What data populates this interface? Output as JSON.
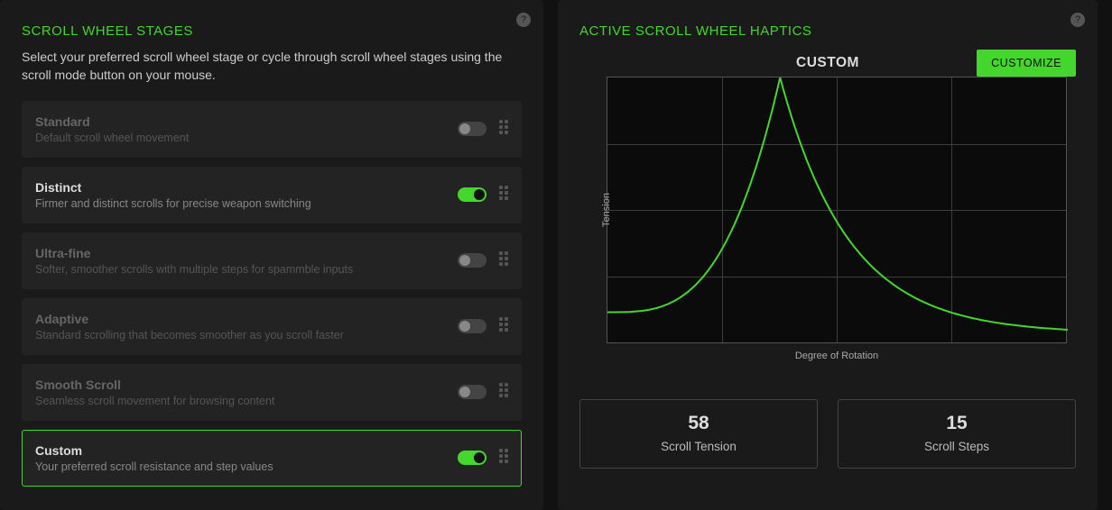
{
  "left": {
    "title": "SCROLL WHEEL STAGES",
    "description": "Select your preferred scroll wheel stage or cycle through scroll wheel stages using the scroll mode button on your mouse.",
    "stages": [
      {
        "title": "Standard",
        "sub": "Default scroll wheel movement",
        "on": false,
        "disabled": true,
        "selected": false
      },
      {
        "title": "Distinct",
        "sub": "Firmer and distinct scrolls for precise weapon switching",
        "on": true,
        "disabled": false,
        "selected": false
      },
      {
        "title": "Ultra-fine",
        "sub": "Softer, smoother scrolls with multiple steps for spammble inputs",
        "on": false,
        "disabled": true,
        "selected": false
      },
      {
        "title": "Adaptive",
        "sub": "Standard scrolling that becomes smoother as you scroll faster",
        "on": false,
        "disabled": true,
        "selected": false
      },
      {
        "title": "Smooth Scroll",
        "sub": "Seamless scroll movement for browsing content",
        "on": false,
        "disabled": true,
        "selected": false
      },
      {
        "title": "Custom",
        "sub": "Your preferred scroll resistance and step values",
        "on": true,
        "disabled": false,
        "selected": true
      }
    ]
  },
  "right": {
    "title": "ACTIVE SCROLL WHEEL HAPTICS",
    "chart_title": "CUSTOM",
    "customize_label": "CUSTOMIZE",
    "xlabel": "Degree of Rotation",
    "ylabel": "Tension",
    "metrics": [
      {
        "value": "58",
        "label": "Scroll Tension"
      },
      {
        "value": "15",
        "label": "Scroll Steps"
      }
    ]
  },
  "chart_data": {
    "type": "line",
    "title": "CUSTOM",
    "xlabel": "Degree of Rotation",
    "ylabel": "Tension",
    "x": [
      0,
      0.125,
      0.25,
      0.375,
      0.5,
      0.625,
      0.75,
      0.875,
      1.0
    ],
    "series": [
      {
        "name": "tension-curve",
        "values": [
          0.12,
          0.14,
          0.22,
          1.0,
          0.22,
          0.14,
          0.09,
          0.06,
          0.04
        ]
      }
    ],
    "xlim": [
      0,
      1
    ],
    "ylim": [
      0,
      1
    ],
    "grid": true
  }
}
